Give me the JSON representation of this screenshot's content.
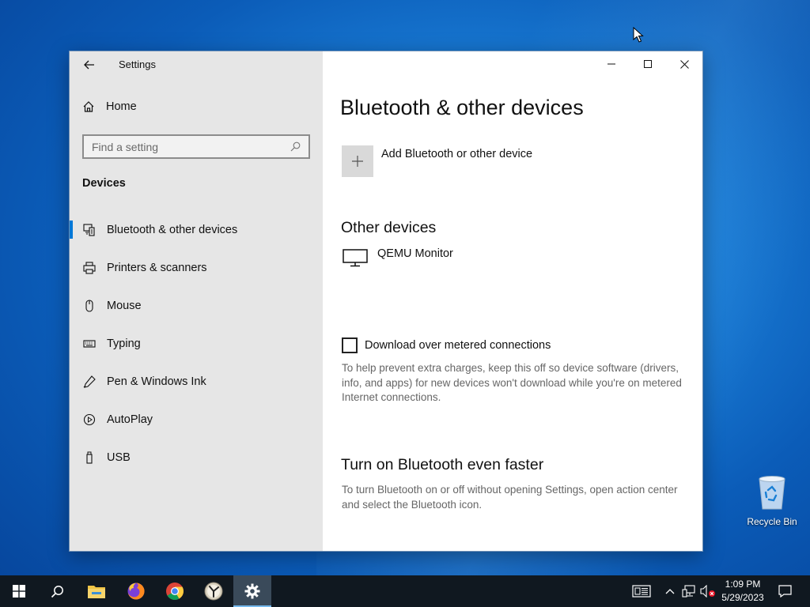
{
  "window": {
    "app_title": "Settings"
  },
  "sidebar": {
    "home_label": "Home",
    "search_placeholder": "Find a setting",
    "section_label": "Devices",
    "items": [
      {
        "label": "Bluetooth & other devices",
        "icon": "bluetooth-devices-icon",
        "active": true
      },
      {
        "label": "Printers & scanners",
        "icon": "printer-icon",
        "active": false
      },
      {
        "label": "Mouse",
        "icon": "mouse-icon",
        "active": false
      },
      {
        "label": "Typing",
        "icon": "keyboard-icon",
        "active": false
      },
      {
        "label": "Pen & Windows Ink",
        "icon": "pen-icon",
        "active": false
      },
      {
        "label": "AutoPlay",
        "icon": "autoplay-icon",
        "active": false
      },
      {
        "label": "USB",
        "icon": "usb-icon",
        "active": false
      }
    ]
  },
  "content": {
    "title": "Bluetooth & other devices",
    "add_device_label": "Add Bluetooth or other device",
    "other_devices_heading": "Other devices",
    "devices": [
      {
        "name": "QEMU Monitor",
        "icon": "monitor-icon"
      }
    ],
    "metered": {
      "label": "Download over metered connections",
      "checked": false,
      "description": "To help prevent extra charges, keep this off so device software (drivers, info, and apps) for new devices won't download while you're on metered Internet connections."
    },
    "faster_heading": "Turn on Bluetooth even faster",
    "faster_description": "To turn Bluetooth on or off without opening Settings, open action center and select the Bluetooth icon."
  },
  "desktop": {
    "recycle_bin_label": "Recycle Bin"
  },
  "taskbar": {
    "apps": [
      "start-icon",
      "search-icon",
      "file-explorer-icon",
      "firefox-icon",
      "chrome-icon",
      "app-icon",
      "settings-icon"
    ],
    "active_app": "settings-icon",
    "clock_time": "1:09 PM",
    "clock_date": "5/29/2023"
  },
  "colors": {
    "accent": "#0078d7",
    "sidebar_bg": "#e6e6e6",
    "taskbar_bg": "#101820"
  }
}
